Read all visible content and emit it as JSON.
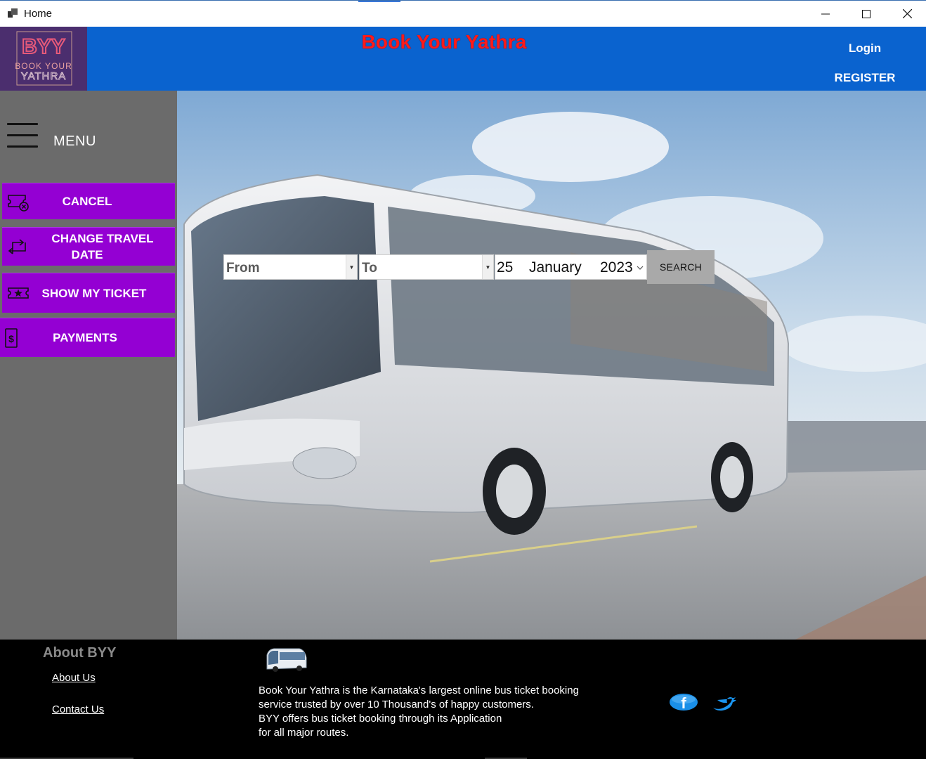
{
  "window": {
    "title": "Home",
    "buttons": [
      "minimize-icon",
      "maximize-icon",
      "close-icon"
    ]
  },
  "header": {
    "logo": {
      "top_text": "BYY",
      "line1": "BOOK YOUR",
      "line2": "YATHRA"
    },
    "site_title": "Book Your Yathra",
    "login_label": "Login",
    "register_label": "REGISTER"
  },
  "sidebar": {
    "menu_label": "MENU",
    "items": [
      {
        "label": "CANCEL",
        "icon": "ticket-cancel-icon"
      },
      {
        "label": "CHANGE TRAVEL DATE",
        "line1": "CHANGE TRAVEL",
        "line2": "DATE",
        "icon": "swap-arrows-icon"
      },
      {
        "label": "SHOW MY TICKET",
        "icon": "ticket-star-icon"
      },
      {
        "label": "PAYMENTS",
        "icon": "dollar-icon"
      }
    ]
  },
  "search": {
    "from_value": "From",
    "to_value": "To",
    "date": {
      "day": "25",
      "month": "January",
      "year": "2023"
    },
    "search_label": "SEARCH"
  },
  "footer": {
    "about_title": "About BYY",
    "links": [
      "About Us",
      "Contact Us"
    ],
    "description": [
      "Book Your Yathra is the Karnataka's largest online bus ticket booking",
      "service trusted by over 10 Thousand's of happy customers.",
      "BYY offers bus ticket booking through its Application",
      "for all major routes."
    ],
    "social": [
      "facebook-icon",
      "twitter-icon"
    ]
  },
  "colors": {
    "header_blue": "#0a63cf",
    "menu_purple": "#9400d3",
    "sidebar_gray": "#6b6b6b",
    "title_red": "#ff1a1a"
  }
}
